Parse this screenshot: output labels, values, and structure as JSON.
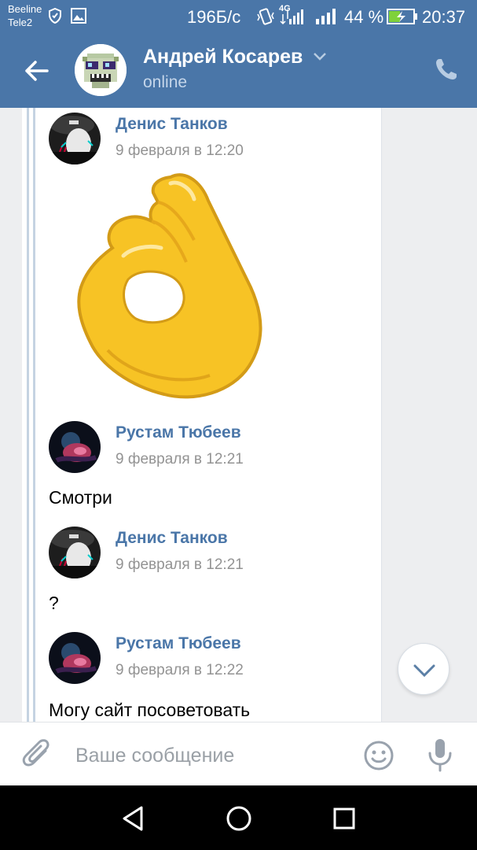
{
  "status_bar": {
    "carrier_1": "Beeline",
    "carrier_2": "Tele2",
    "network_speed": "196Б/с",
    "network_type": "4G",
    "battery_percent": "44 %",
    "time": "20:37"
  },
  "header": {
    "contact_name": "Андрей Косарев",
    "contact_status": "online"
  },
  "messages": [
    {
      "author": "Денис Танков",
      "date": "9 февраля в 12:20",
      "text": "",
      "sticker": "ok-hand-sticker"
    },
    {
      "author": "Рустам Тюбеев",
      "date": "9 февраля в 12:21",
      "text": "Смотри"
    },
    {
      "author": "Денис Танков",
      "date": "9 февраля в 12:21",
      "text": "?"
    },
    {
      "author": "Рустам Тюбеев",
      "date": "9 февраля в 12:22",
      "text": "Могу сайт посоветовать"
    }
  ],
  "input": {
    "placeholder": "Ваше сообщение",
    "value": ""
  },
  "colors": {
    "brand": "#4a76a8",
    "author_link": "#4a76a8",
    "sticker_fill": "#f7c325"
  }
}
